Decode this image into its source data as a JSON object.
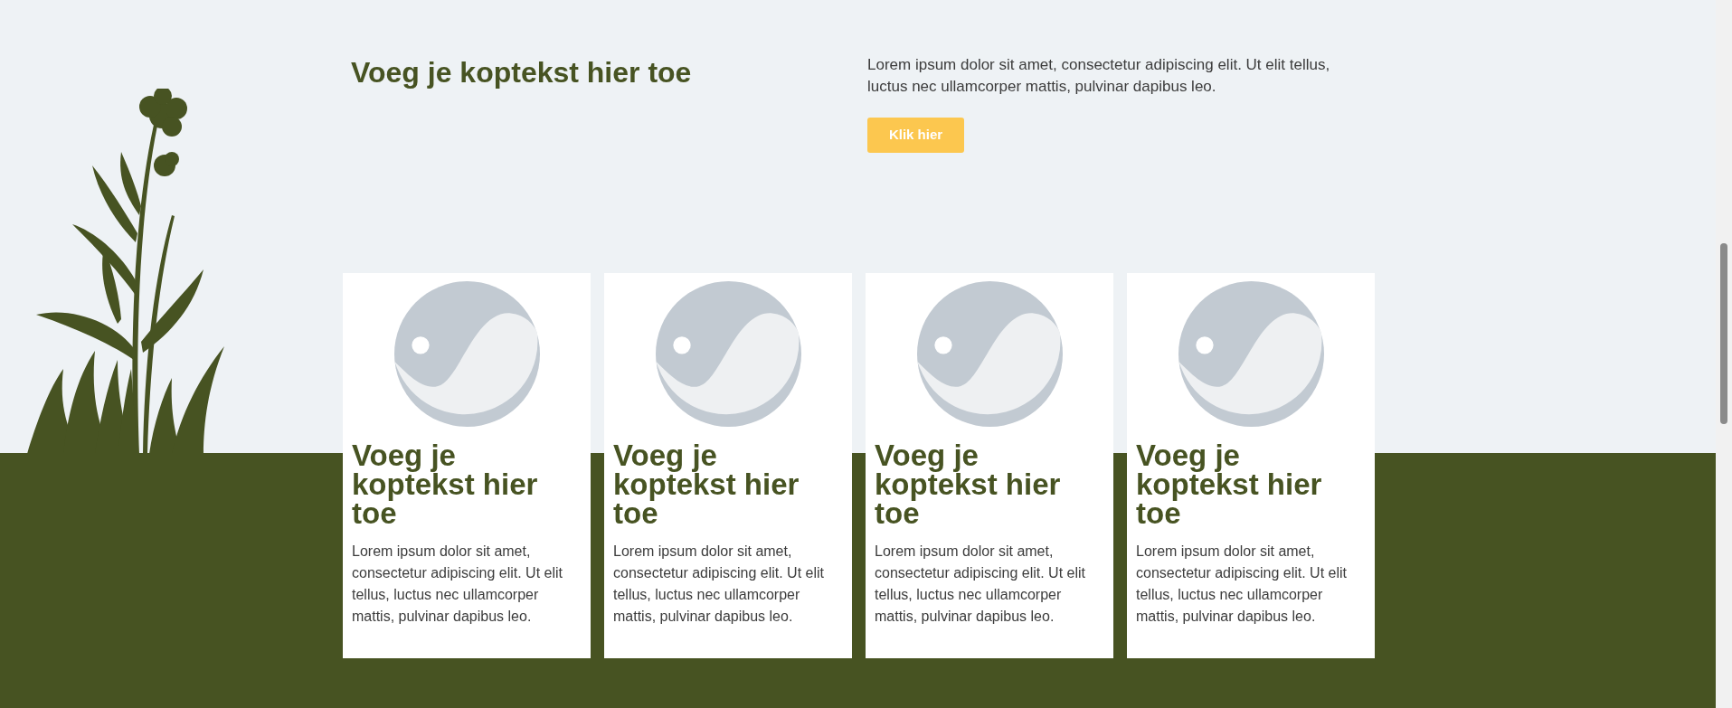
{
  "hero": {
    "heading": "Voeg je koptekst hier toe",
    "text": "Lorem ipsum dolor sit amet, consectetur adipiscing elit. Ut elit tellus, luctus nec ullamcorper mattis, pulvinar dapibus leo.",
    "button": "Klik hier"
  },
  "cards": [
    {
      "heading": "Voeg je koptekst hier toe",
      "text": "Lorem ipsum dolor sit amet, consectetur adipiscing elit. Ut elit tellus, luctus nec ullamcorper mattis, pulvinar dapibus leo."
    },
    {
      "heading": "Voeg je koptekst hier toe",
      "text": "Lorem ipsum dolor sit amet, consectetur adipiscing elit. Ut elit tellus, luctus nec ullamcorper mattis, pulvinar dapibus leo."
    },
    {
      "heading": "Voeg je koptekst hier toe",
      "text": "Lorem ipsum dolor sit amet, consectetur adipiscing elit. Ut elit tellus, luctus nec ullamcorper mattis, pulvinar dapibus leo."
    },
    {
      "heading": "Voeg je koptekst hier toe",
      "text": "Lorem ipsum dolor sit amet, consectetur adipiscing elit. Ut elit tellus, luctus nec ullamcorper mattis, pulvinar dapibus leo."
    }
  ]
}
